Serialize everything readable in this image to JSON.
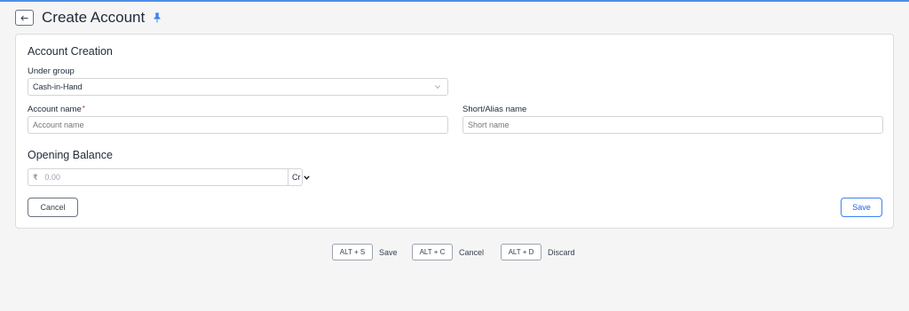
{
  "header": {
    "back_icon": "arrow-left-icon",
    "title": "Create Account",
    "pin_icon": "pin-icon",
    "accent_color": "#3b82f6"
  },
  "account_creation": {
    "section_title": "Account Creation",
    "under_group": {
      "label": "Under group",
      "value": "Cash-in-Hand"
    },
    "account_name": {
      "label": "Account name",
      "required_mark": "*",
      "placeholder": "Account name"
    },
    "short_name": {
      "label": "Short/Alias name",
      "placeholder": "Short name"
    }
  },
  "opening_balance": {
    "section_title": "Opening Balance",
    "currency_symbol": "₹",
    "placeholder": "0.00",
    "type_value": "Cr"
  },
  "actions": {
    "cancel_label": "Cancel",
    "save_label": "Save"
  },
  "shortcuts": [
    {
      "keys": "ALT + S",
      "label": "Save"
    },
    {
      "keys": "ALT + C",
      "label": "Cancel"
    },
    {
      "keys": "ALT + D",
      "label": "Discard"
    }
  ]
}
